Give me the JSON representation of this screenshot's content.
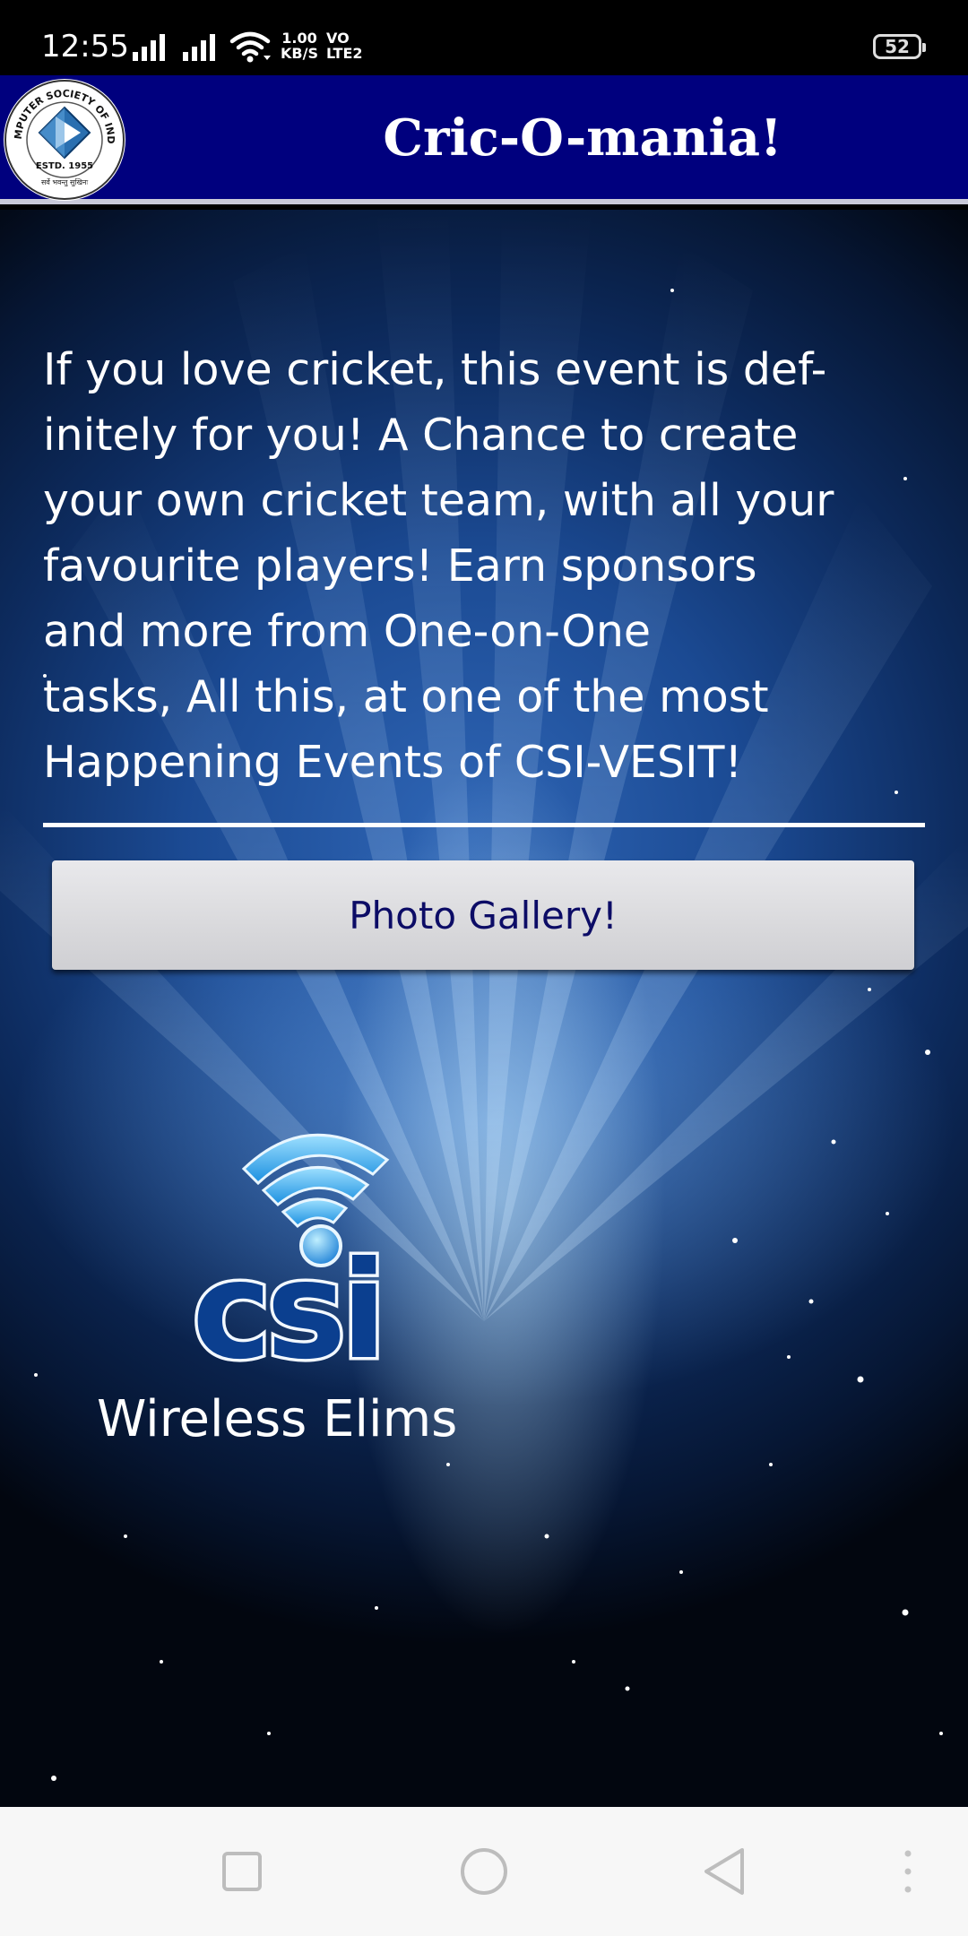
{
  "status_bar": {
    "time": "12:55",
    "speed_value": "1.00",
    "speed_unit": "KB/S",
    "volte_line1": "VO",
    "volte_line2": "LTE2",
    "battery": "52"
  },
  "app_bar": {
    "title": "Cric-O-mania!",
    "logo": {
      "top_text": "COMPUTER SOCIETY OF INDIA",
      "estd": "ESTD. 1955",
      "motto": "सर्वे भवन्तु सुखिनः"
    }
  },
  "main": {
    "description": "If you love cricket, this event is def-\ninitely for you! A Chance to create\nyour own cricket team, with all your\nfavourite players! Earn sponsors\nand more from One-on-One\ntasks, All this, at one of the most\nHappening Events of CSI-VESIT!",
    "gallery_button": "Photo Gallery!",
    "csi_logo_text": "csi",
    "wireless_label": "Wireless Elims"
  },
  "nav_bar": {
    "icons": [
      "recents-icon",
      "home-icon",
      "back-icon",
      "more-icon"
    ]
  },
  "colors": {
    "app_bar": "#00007e",
    "button_text": "#0c0c66",
    "background_center": "#2f66b6",
    "background_edge": "#02060f"
  }
}
